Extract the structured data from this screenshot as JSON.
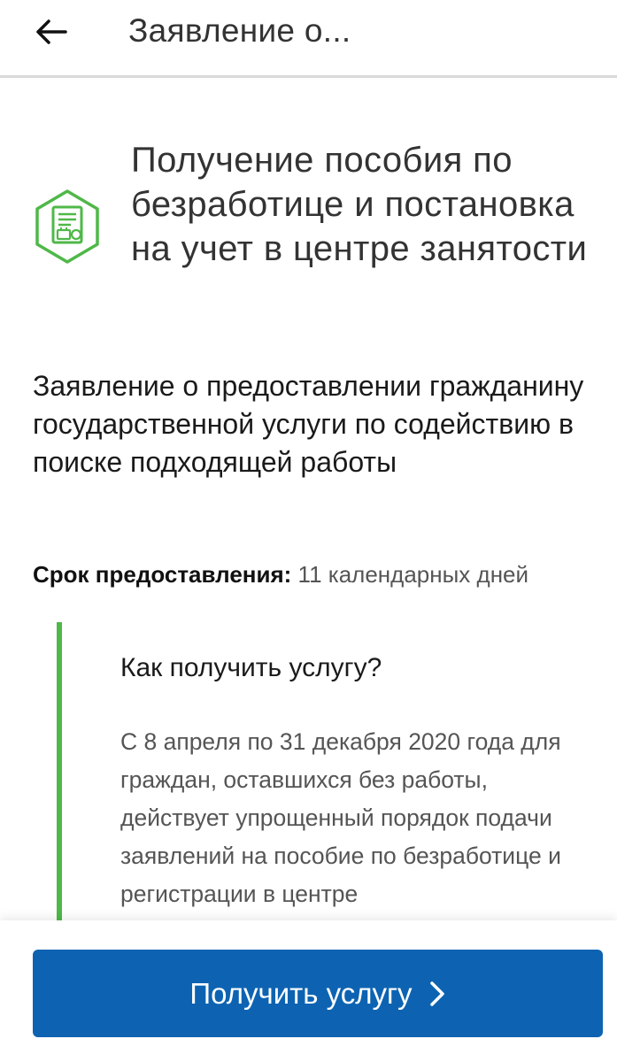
{
  "header": {
    "back_icon": "arrow-left-icon",
    "title": "Заявление о..."
  },
  "service": {
    "icon": "document-briefcase-icon",
    "icon_color": "#4fb848",
    "name": "Получение пособия по безработице и постановка на учет в центре занятости"
  },
  "application": {
    "title": "Заявление о предоставлении гражданину государственной услуги по содействию в поиске подходящей работы"
  },
  "term": {
    "label": "Срок предоставления:",
    "value": "11 календарных дней"
  },
  "info": {
    "accent_color": "#4fb848",
    "heading": "Как получить услугу?",
    "text": "С 8 апреля по 31 декабря 2020 года для граждан, оставшихся без работы, действует упрощенный порядок подачи заявлений на пособие по безработице и регистрации в центре"
  },
  "cta": {
    "label": "Получить услугу",
    "icon": "chevron-right-icon",
    "color": "#0d63b2"
  }
}
